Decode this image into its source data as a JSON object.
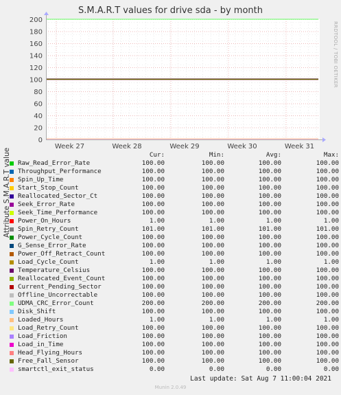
{
  "chart_data": {
    "type": "line",
    "title": "S.M.A.R.T values for drive sda - by month",
    "ylabel": "Attribute S.M.A.R.T value",
    "ylim": [
      0,
      200
    ],
    "yticks": [
      0,
      20,
      40,
      60,
      80,
      100,
      120,
      140,
      160,
      180,
      200
    ],
    "xticks": [
      "Week 27",
      "Week 28",
      "Week 29",
      "Week 30",
      "Week 31"
    ],
    "grid": true,
    "series": [
      {
        "name": "Raw_Read_Error_Rate",
        "color": "#00cc00",
        "cur": "100.00",
        "min": "100.00",
        "avg": "100.00",
        "max": "100.00"
      },
      {
        "name": "Throughput_Performance",
        "color": "#0066b3",
        "cur": "100.00",
        "min": "100.00",
        "avg": "100.00",
        "max": "100.00"
      },
      {
        "name": "Spin_Up_Time",
        "color": "#ff8000",
        "cur": "100.00",
        "min": "100.00",
        "avg": "100.00",
        "max": "100.00"
      },
      {
        "name": "Start_Stop_Count",
        "color": "#ffcc00",
        "cur": "100.00",
        "min": "100.00",
        "avg": "100.00",
        "max": "100.00"
      },
      {
        "name": "Reallocated_Sector_Ct",
        "color": "#330099",
        "cur": "100.00",
        "min": "100.00",
        "avg": "100.00",
        "max": "100.00"
      },
      {
        "name": "Seek_Error_Rate",
        "color": "#990099",
        "cur": "100.00",
        "min": "100.00",
        "avg": "100.00",
        "max": "100.00"
      },
      {
        "name": "Seek_Time_Performance",
        "color": "#ccff00",
        "cur": "100.00",
        "min": "100.00",
        "avg": "100.00",
        "max": "100.00"
      },
      {
        "name": "Power_On_Hours",
        "color": "#ff0000",
        "cur": "1.00",
        "min": "1.00",
        "avg": "1.00",
        "max": "1.00"
      },
      {
        "name": "Spin_Retry_Count",
        "color": "#808080",
        "cur": "101.00",
        "min": "101.00",
        "avg": "101.00",
        "max": "101.00"
      },
      {
        "name": "Power_Cycle_Count",
        "color": "#008f00",
        "cur": "100.00",
        "min": "100.00",
        "avg": "100.00",
        "max": "100.00"
      },
      {
        "name": "G_Sense_Error_Rate",
        "color": "#00487d",
        "cur": "100.00",
        "min": "100.00",
        "avg": "100.00",
        "max": "100.00"
      },
      {
        "name": "Power_Off_Retract_Count",
        "color": "#b35a00",
        "cur": "100.00",
        "min": "100.00",
        "avg": "100.00",
        "max": "100.00"
      },
      {
        "name": "Load_Cycle_Count",
        "color": "#b38f00",
        "cur": "1.00",
        "min": "1.00",
        "avg": "1.00",
        "max": "1.00"
      },
      {
        "name": "Temperature_Celsius",
        "color": "#6b006b",
        "cur": "100.00",
        "min": "100.00",
        "avg": "100.00",
        "max": "100.00"
      },
      {
        "name": "Reallocated_Event_Count",
        "color": "#8fb300",
        "cur": "100.00",
        "min": "100.00",
        "avg": "100.00",
        "max": "100.00"
      },
      {
        "name": "Current_Pending_Sector",
        "color": "#b30000",
        "cur": "100.00",
        "min": "100.00",
        "avg": "100.00",
        "max": "100.00"
      },
      {
        "name": "Offline_Uncorrectable",
        "color": "#bebebe",
        "cur": "100.00",
        "min": "100.00",
        "avg": "100.00",
        "max": "100.00"
      },
      {
        "name": "UDMA_CRC_Error_Count",
        "color": "#80ff80",
        "cur": "200.00",
        "min": "200.00",
        "avg": "200.00",
        "max": "200.00"
      },
      {
        "name": "Disk_Shift",
        "color": "#80c9ff",
        "cur": "100.00",
        "min": "100.00",
        "avg": "100.00",
        "max": "100.00"
      },
      {
        "name": "Loaded_Hours",
        "color": "#ffc080",
        "cur": "1.00",
        "min": "1.00",
        "avg": "1.00",
        "max": "1.00"
      },
      {
        "name": "Load_Retry_Count",
        "color": "#ffe680",
        "cur": "100.00",
        "min": "100.00",
        "avg": "100.00",
        "max": "100.00"
      },
      {
        "name": "Load_Friction",
        "color": "#aa80ff",
        "cur": "100.00",
        "min": "100.00",
        "avg": "100.00",
        "max": "100.00"
      },
      {
        "name": "Load_in_Time",
        "color": "#ee00cc",
        "cur": "100.00",
        "min": "100.00",
        "avg": "100.00",
        "max": "100.00"
      },
      {
        "name": "Head_Flying_Hours",
        "color": "#ff8080",
        "cur": "100.00",
        "min": "100.00",
        "avg": "100.00",
        "max": "100.00"
      },
      {
        "name": "Free_Fall_Sensor",
        "color": "#666600",
        "cur": "100.00",
        "min": "100.00",
        "avg": "100.00",
        "max": "100.00"
      },
      {
        "name": "smartctl_exit_status",
        "color": "#ffbfff",
        "cur": "0.00",
        "min": "0.00",
        "avg": "0.00",
        "max": "0.00"
      }
    ]
  },
  "legend": {
    "cur": "Cur:",
    "min": "Min:",
    "avg": "Avg:",
    "max": "Max:"
  },
  "side_label": "RRDTOOL / TOBI OETIKER",
  "last_update": "Last update: Sat Aug  7 11:00:04 2021",
  "footer": "Munin 2.0.49"
}
